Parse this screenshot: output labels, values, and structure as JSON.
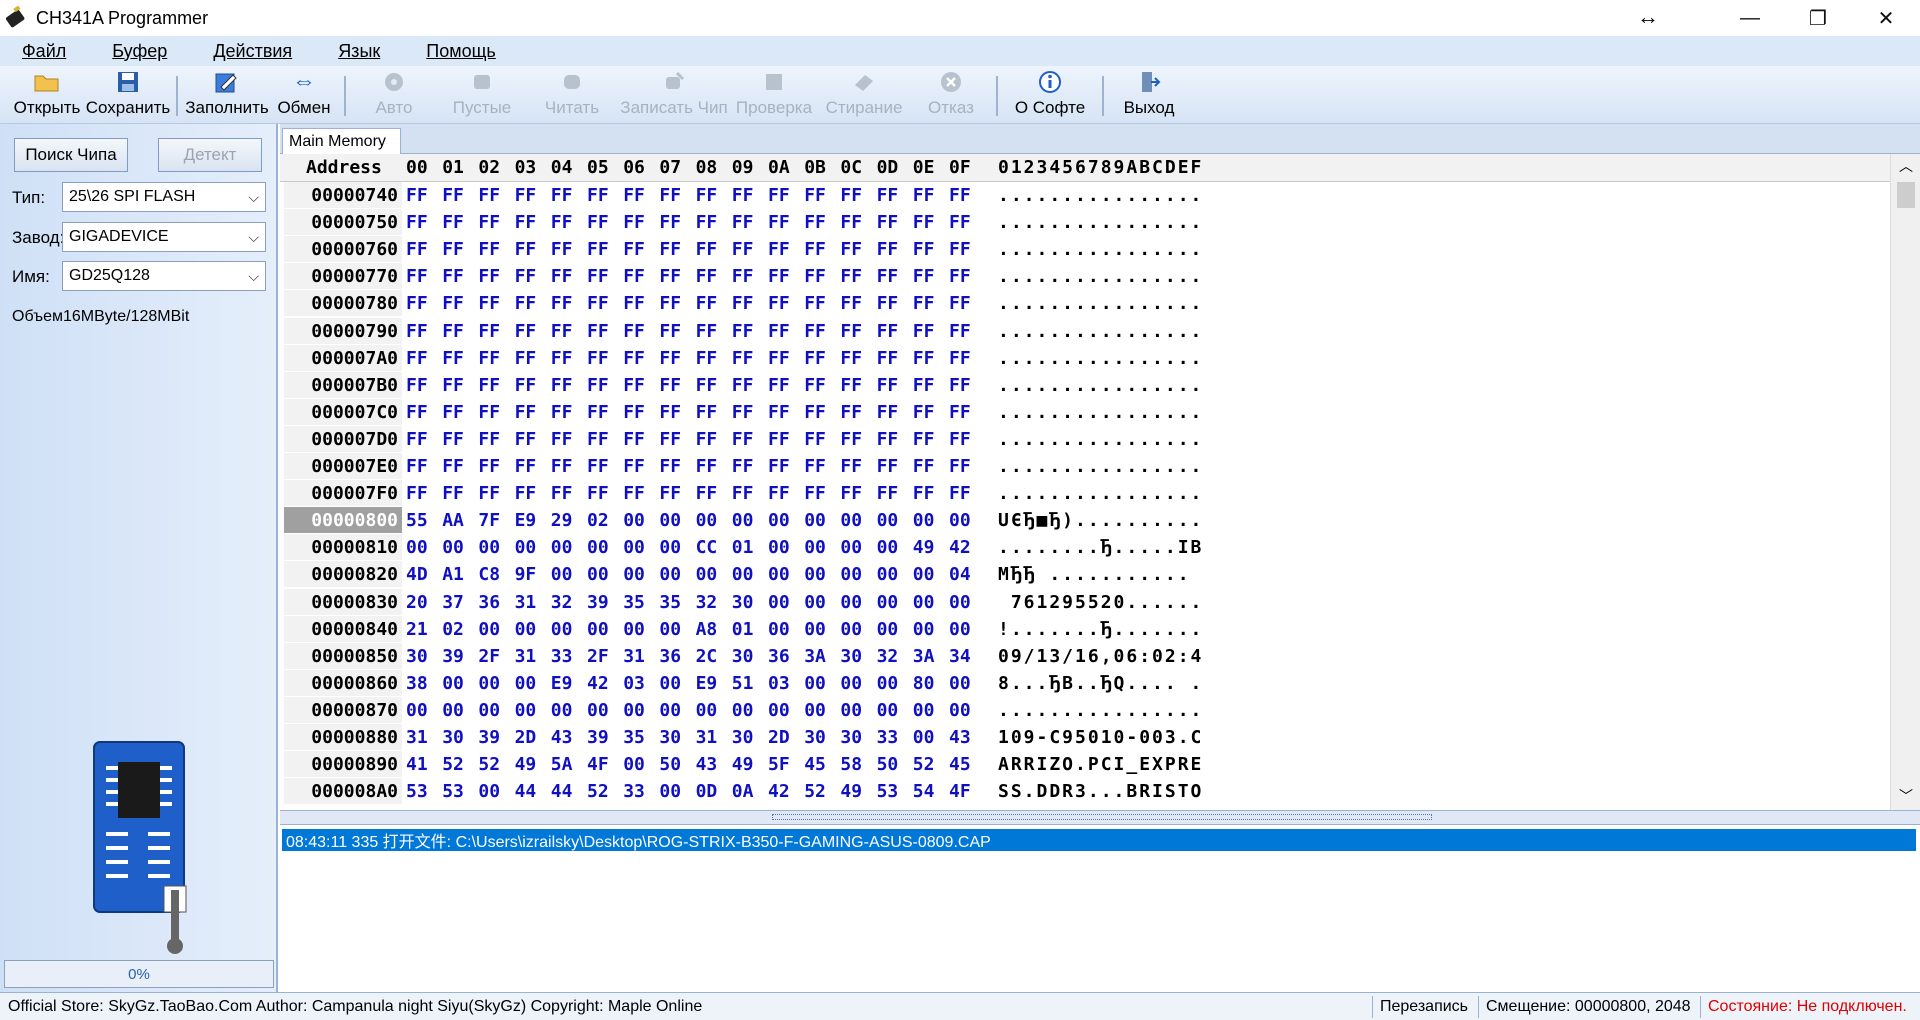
{
  "window": {
    "title": "CH341A Programmer"
  },
  "menu": [
    "Файл",
    "Буфер",
    "Действия",
    "Язык",
    "Помощь"
  ],
  "toolbar": {
    "open": "Открыть",
    "save": "Сохранить",
    "fill": "Заполнить",
    "swap": "Обмен",
    "auto": "Авто",
    "blank": "Пустые",
    "read": "Читать",
    "write": "Записать Чип",
    "verify": "Проверка",
    "erase": "Стирание",
    "cancel": "Отказ",
    "about": "О Софте",
    "exit": "Выход"
  },
  "left": {
    "search_btn": "Поиск Чипа",
    "detect_btn": "Детект",
    "type_label": "Тип:",
    "type_value": "25\\26 SPI FLASH",
    "vendor_label": "Завод:",
    "vendor_value": "GIGADEVICE",
    "name_label": "Имя:",
    "name_value": "GD25Q128",
    "size_text": "Объем16MByte/128MBit",
    "progress": "0%"
  },
  "hex": {
    "tab": "Main Memory",
    "addr_header": "Address",
    "cols": [
      "00",
      "01",
      "02",
      "03",
      "04",
      "05",
      "06",
      "07",
      "08",
      "09",
      "0A",
      "0B",
      "0C",
      "0D",
      "0E",
      "0F"
    ],
    "ascii_header": "0123456789ABCDEF",
    "selected_row": "00000800",
    "rows": [
      {
        "a": "00000740",
        "b": [
          "FF",
          "FF",
          "FF",
          "FF",
          "FF",
          "FF",
          "FF",
          "FF",
          "FF",
          "FF",
          "FF",
          "FF",
          "FF",
          "FF",
          "FF",
          "FF"
        ],
        "t": "................"
      },
      {
        "a": "00000750",
        "b": [
          "FF",
          "FF",
          "FF",
          "FF",
          "FF",
          "FF",
          "FF",
          "FF",
          "FF",
          "FF",
          "FF",
          "FF",
          "FF",
          "FF",
          "FF",
          "FF"
        ],
        "t": "................"
      },
      {
        "a": "00000760",
        "b": [
          "FF",
          "FF",
          "FF",
          "FF",
          "FF",
          "FF",
          "FF",
          "FF",
          "FF",
          "FF",
          "FF",
          "FF",
          "FF",
          "FF",
          "FF",
          "FF"
        ],
        "t": "................"
      },
      {
        "a": "00000770",
        "b": [
          "FF",
          "FF",
          "FF",
          "FF",
          "FF",
          "FF",
          "FF",
          "FF",
          "FF",
          "FF",
          "FF",
          "FF",
          "FF",
          "FF",
          "FF",
          "FF"
        ],
        "t": "................"
      },
      {
        "a": "00000780",
        "b": [
          "FF",
          "FF",
          "FF",
          "FF",
          "FF",
          "FF",
          "FF",
          "FF",
          "FF",
          "FF",
          "FF",
          "FF",
          "FF",
          "FF",
          "FF",
          "FF"
        ],
        "t": "................"
      },
      {
        "a": "00000790",
        "b": [
          "FF",
          "FF",
          "FF",
          "FF",
          "FF",
          "FF",
          "FF",
          "FF",
          "FF",
          "FF",
          "FF",
          "FF",
          "FF",
          "FF",
          "FF",
          "FF"
        ],
        "t": "................"
      },
      {
        "a": "000007A0",
        "b": [
          "FF",
          "FF",
          "FF",
          "FF",
          "FF",
          "FF",
          "FF",
          "FF",
          "FF",
          "FF",
          "FF",
          "FF",
          "FF",
          "FF",
          "FF",
          "FF"
        ],
        "t": "................"
      },
      {
        "a": "000007B0",
        "b": [
          "FF",
          "FF",
          "FF",
          "FF",
          "FF",
          "FF",
          "FF",
          "FF",
          "FF",
          "FF",
          "FF",
          "FF",
          "FF",
          "FF",
          "FF",
          "FF"
        ],
        "t": "................"
      },
      {
        "a": "000007C0",
        "b": [
          "FF",
          "FF",
          "FF",
          "FF",
          "FF",
          "FF",
          "FF",
          "FF",
          "FF",
          "FF",
          "FF",
          "FF",
          "FF",
          "FF",
          "FF",
          "FF"
        ],
        "t": "................"
      },
      {
        "a": "000007D0",
        "b": [
          "FF",
          "FF",
          "FF",
          "FF",
          "FF",
          "FF",
          "FF",
          "FF",
          "FF",
          "FF",
          "FF",
          "FF",
          "FF",
          "FF",
          "FF",
          "FF"
        ],
        "t": "................"
      },
      {
        "a": "000007E0",
        "b": [
          "FF",
          "FF",
          "FF",
          "FF",
          "FF",
          "FF",
          "FF",
          "FF",
          "FF",
          "FF",
          "FF",
          "FF",
          "FF",
          "FF",
          "FF",
          "FF"
        ],
        "t": "................"
      },
      {
        "a": "000007F0",
        "b": [
          "FF",
          "FF",
          "FF",
          "FF",
          "FF",
          "FF",
          "FF",
          "FF",
          "FF",
          "FF",
          "FF",
          "FF",
          "FF",
          "FF",
          "FF",
          "FF"
        ],
        "t": "................"
      },
      {
        "a": "00000800",
        "b": [
          "55",
          "AA",
          "7F",
          "E9",
          "29",
          "02",
          "00",
          "00",
          "00",
          "00",
          "00",
          "00",
          "00",
          "00",
          "00",
          "00"
        ],
        "t": "UЄЂ■Ђ).........."
      },
      {
        "a": "00000810",
        "b": [
          "00",
          "00",
          "00",
          "00",
          "00",
          "00",
          "00",
          "00",
          "CC",
          "01",
          "00",
          "00",
          "00",
          "00",
          "49",
          "42"
        ],
        "t": "........Ђ.....IB"
      },
      {
        "a": "00000820",
        "b": [
          "4D",
          "A1",
          "C8",
          "9F",
          "00",
          "00",
          "00",
          "00",
          "00",
          "00",
          "00",
          "00",
          "00",
          "00",
          "00",
          "04"
        ],
        "t": "MЂЂ ..........."
      },
      {
        "a": "00000830",
        "b": [
          "20",
          "37",
          "36",
          "31",
          "32",
          "39",
          "35",
          "35",
          "32",
          "30",
          "00",
          "00",
          "00",
          "00",
          "00",
          "00"
        ],
        "t": " 761295520......"
      },
      {
        "a": "00000840",
        "b": [
          "21",
          "02",
          "00",
          "00",
          "00",
          "00",
          "00",
          "00",
          "A8",
          "01",
          "00",
          "00",
          "00",
          "00",
          "00",
          "00"
        ],
        "t": "!.......Ђ......."
      },
      {
        "a": "00000850",
        "b": [
          "30",
          "39",
          "2F",
          "31",
          "33",
          "2F",
          "31",
          "36",
          "2C",
          "30",
          "36",
          "3A",
          "30",
          "32",
          "3A",
          "34"
        ],
        "t": "09/13/16,06:02:4"
      },
      {
        "a": "00000860",
        "b": [
          "38",
          "00",
          "00",
          "00",
          "E9",
          "42",
          "03",
          "00",
          "E9",
          "51",
          "03",
          "00",
          "00",
          "00",
          "80",
          "00"
        ],
        "t": "8...ЂB..ЂQ.... ."
      },
      {
        "a": "00000870",
        "b": [
          "00",
          "00",
          "00",
          "00",
          "00",
          "00",
          "00",
          "00",
          "00",
          "00",
          "00",
          "00",
          "00",
          "00",
          "00",
          "00"
        ],
        "t": "................"
      },
      {
        "a": "00000880",
        "b": [
          "31",
          "30",
          "39",
          "2D",
          "43",
          "39",
          "35",
          "30",
          "31",
          "30",
          "2D",
          "30",
          "30",
          "33",
          "00",
          "43"
        ],
        "t": "109-C95010-003.C"
      },
      {
        "a": "00000890",
        "b": [
          "41",
          "52",
          "52",
          "49",
          "5A",
          "4F",
          "00",
          "50",
          "43",
          "49",
          "5F",
          "45",
          "58",
          "50",
          "52",
          "45"
        ],
        "t": "ARRIZO.PCI_EXPRE"
      },
      {
        "a": "000008A0",
        "b": [
          "53",
          "53",
          "00",
          "44",
          "44",
          "52",
          "33",
          "00",
          "0D",
          "0A",
          "42",
          "52",
          "49",
          "53",
          "54",
          "4F"
        ],
        "t": "SS.DDR3...BRISTO"
      }
    ]
  },
  "log": {
    "line": "08:43:11 335 打开文件: C:\\Users\\izrailsky\\Desktop\\ROG-STRIX-B350-F-GAMING-ASUS-0809.CAP"
  },
  "status": {
    "left": "Official Store: SkyGz.TaoBao.Com Author: Campanula night Siyu(SkyGz) Copyright: Maple Online",
    "mode": "Перезапись",
    "offset": "Смещение: 00000800, 2048",
    "state": "Состояние: Не подключен.",
    "state_color": "#e00000"
  }
}
